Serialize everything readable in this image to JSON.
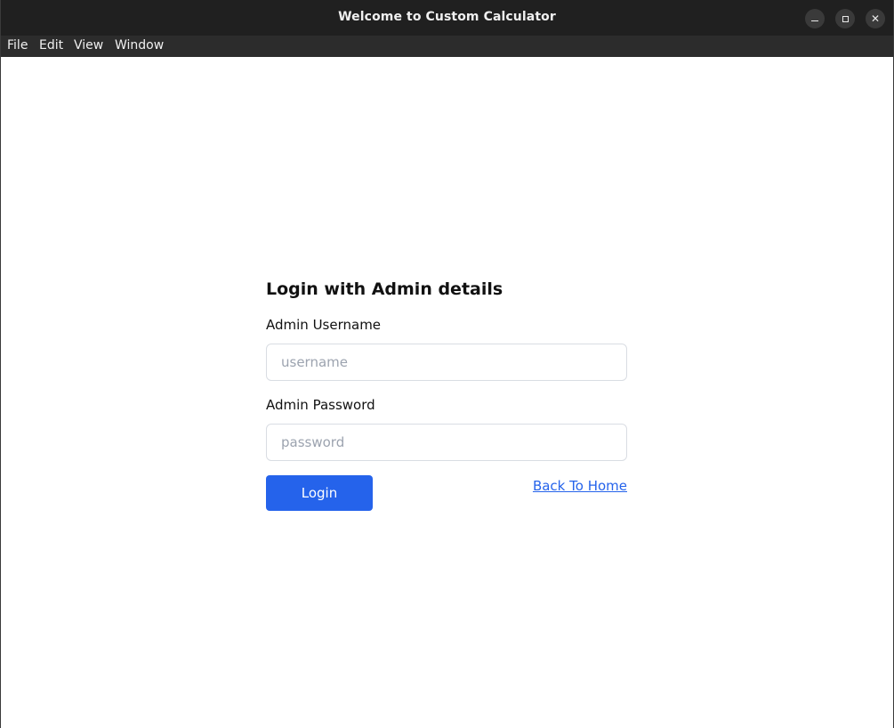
{
  "window": {
    "title": "Welcome to Custom Calculator",
    "controls": {
      "minimize_icon": "minimize-icon",
      "maximize_icon": "maximize-icon",
      "close_icon": "close-icon"
    }
  },
  "menubar": {
    "items": [
      "File",
      "Edit",
      "View",
      "Window"
    ]
  },
  "form": {
    "heading": "Login with Admin details",
    "username_label": "Admin Username",
    "username_placeholder": "username",
    "password_label": "Admin Password",
    "password_placeholder": "password",
    "login_label": "Login",
    "back_link": "Back To Home"
  },
  "colors": {
    "accent": "#2563eb",
    "titlebar": "#202020",
    "menubar": "#2c2c2c"
  }
}
